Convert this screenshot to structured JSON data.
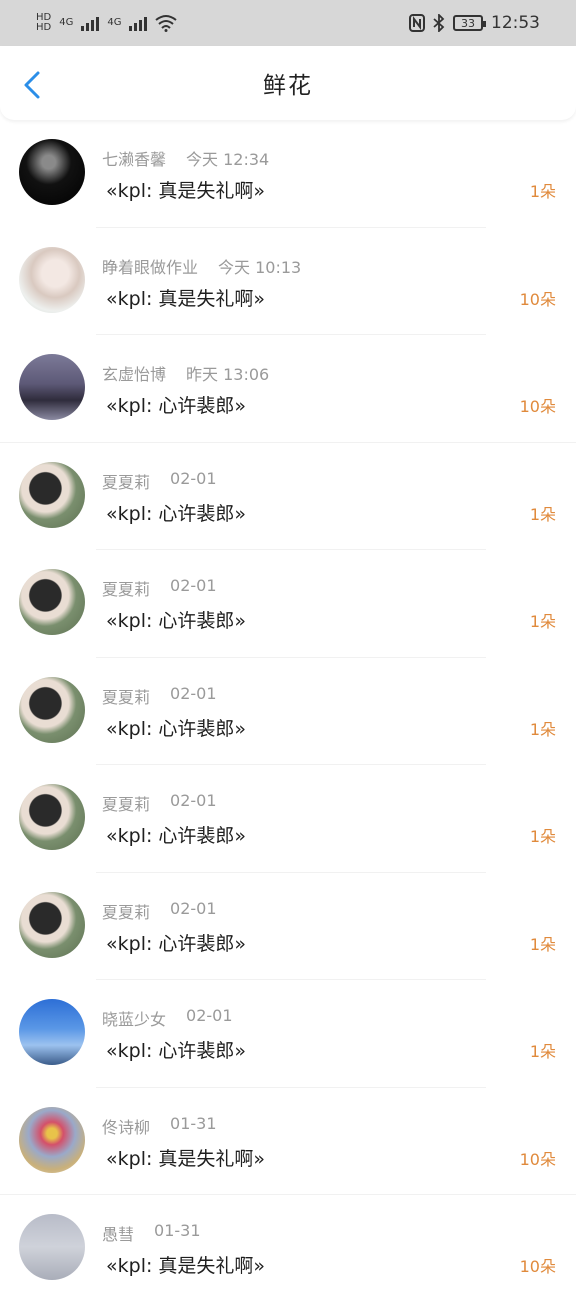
{
  "status_bar": {
    "network_1": "4G",
    "network_2": "4G",
    "battery": "33",
    "time": "12:53"
  },
  "header": {
    "title": "鲜花"
  },
  "items": [
    {
      "name": "七濑香馨",
      "time": "今天 12:34",
      "message": "«kpl: 真是失礼啊»",
      "count": "1朵"
    },
    {
      "name": "睁着眼做作业",
      "time": "今天 10:13",
      "message": "«kpl: 真是失礼啊»",
      "count": "10朵"
    },
    {
      "name": "玄虚怡博",
      "time": "昨天 13:06",
      "message": "«kpl: 心许裴郎»",
      "count": "10朵"
    },
    {
      "name": "夏夏莉",
      "time": "02-01",
      "message": "«kpl: 心许裴郎»",
      "count": "1朵"
    },
    {
      "name": "夏夏莉",
      "time": "02-01",
      "message": "«kpl: 心许裴郎»",
      "count": "1朵"
    },
    {
      "name": "夏夏莉",
      "time": "02-01",
      "message": "«kpl: 心许裴郎»",
      "count": "1朵"
    },
    {
      "name": "夏夏莉",
      "time": "02-01",
      "message": "«kpl: 心许裴郎»",
      "count": "1朵"
    },
    {
      "name": "夏夏莉",
      "time": "02-01",
      "message": "«kpl: 心许裴郎»",
      "count": "1朵"
    },
    {
      "name": "晓蓝少女",
      "time": "02-01",
      "message": "«kpl: 心许裴郎»",
      "count": "1朵"
    },
    {
      "name": "佟诗柳",
      "time": "01-31",
      "message": "«kpl: 真是失礼啊»",
      "count": "10朵"
    },
    {
      "name": "愚彗",
      "time": "01-31",
      "message": "«kpl: 真是失礼啊»",
      "count": "10朵"
    }
  ],
  "colors": {
    "accent": "#2b8ee8",
    "count": "#e08a3c"
  },
  "icons": {
    "back": "chevron-left-icon",
    "wifi": "wifi-icon",
    "nfc": "nfc-icon",
    "bluetooth": "bluetooth-icon"
  }
}
